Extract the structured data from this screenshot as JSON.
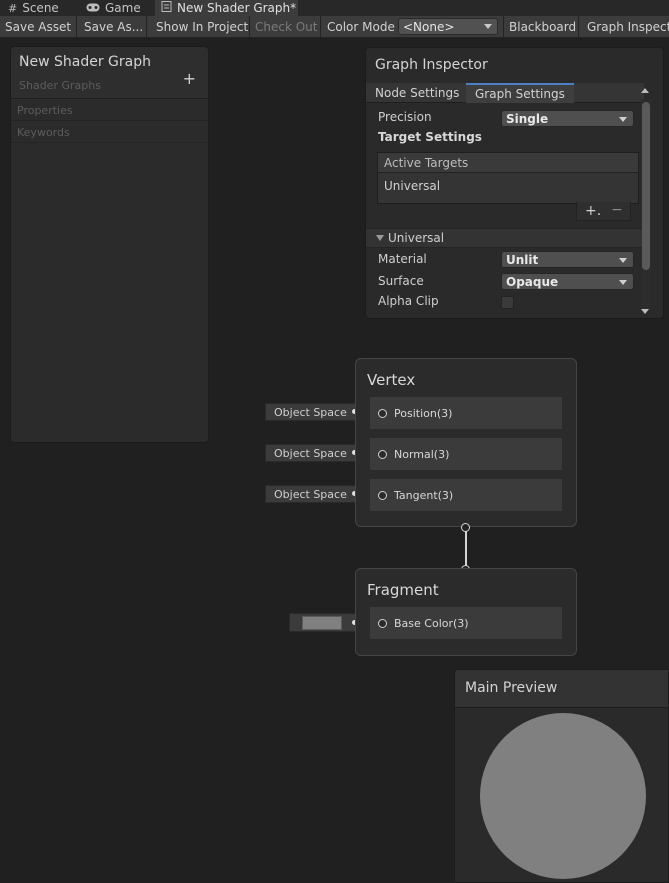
{
  "tabs": [
    {
      "label": "Scene",
      "icon": "grid-icon"
    },
    {
      "label": "Game",
      "icon": "gamepad-icon"
    },
    {
      "label": "New Shader Graph*",
      "icon": "shader-graph-icon"
    }
  ],
  "toolbar": {
    "save_asset": "Save Asset",
    "save_as": "Save As...",
    "show_in_project": "Show In Project",
    "check_out": "Check Out",
    "color_mode_label": "Color Mode",
    "color_mode_value": "<None>",
    "blackboard": "Blackboard",
    "graph_inspector": "Graph Inspector"
  },
  "blackboard": {
    "title": "New Shader Graph",
    "subtitle": "Shader Graphs",
    "add_symbol": "+",
    "sections": [
      "Properties",
      "Keywords"
    ]
  },
  "inspector": {
    "title": "Graph Inspector",
    "tabs": [
      "Node Settings",
      "Graph Settings"
    ],
    "active_tab": "Graph Settings",
    "precision_label": "Precision",
    "precision_value": "Single",
    "target_settings": "Target Settings",
    "active_targets_header": "Active Targets",
    "active_targets": [
      "Universal"
    ],
    "add_symbol": "+.",
    "remove_symbol": "−",
    "foldout": "Universal",
    "material_label": "Material",
    "material_value": "Unlit",
    "surface_label": "Surface",
    "surface_value": "Opaque",
    "alpha_clip_label": "Alpha Clip",
    "alpha_clip_checked": false
  },
  "vertex": {
    "title": "Vertex",
    "slots": [
      {
        "label": "Position(3)",
        "input": "Object Space"
      },
      {
        "label": "Normal(3)",
        "input": "Object Space"
      },
      {
        "label": "Tangent(3)",
        "input": "Object Space"
      }
    ]
  },
  "fragment": {
    "title": "Fragment",
    "slots": [
      {
        "label": "Base Color(3)",
        "input_color": "#808080"
      }
    ]
  },
  "preview": {
    "title": "Main Preview",
    "sphere_color": "#808080"
  }
}
